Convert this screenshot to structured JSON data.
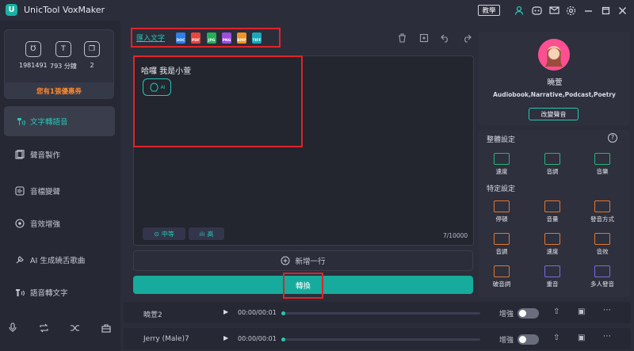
{
  "app": {
    "title": "UnicTool VoxMaker",
    "logo_letter": "U"
  },
  "titlebar": {
    "guide_label": "教學"
  },
  "stats": {
    "characters": "1981491",
    "minutes": "793 分鐘",
    "count": "2",
    "coupon": "您有1張優惠券"
  },
  "nav": {
    "items": [
      {
        "label": "文字轉語音",
        "active": true,
        "icon": "text-voice-icon"
      },
      {
        "label": "聲音製作",
        "icon": "voice-make-icon"
      },
      {
        "label": "音檔變聲",
        "icon": "voice-change-icon"
      },
      {
        "label": "音效增強",
        "icon": "enhance-icon"
      },
      {
        "label": "AI 生成繞舌歌曲",
        "icon": "rap-icon"
      },
      {
        "label": "語音轉文字",
        "icon": "speech-text-icon"
      }
    ]
  },
  "toolbar": {
    "import_label": "匯入文字",
    "file_types": [
      "DOC",
      "PDF",
      "JPG",
      "PNG",
      "BMP",
      "TIFF"
    ]
  },
  "editor": {
    "text": "哈囉 我是小萱",
    "ai_chip": "AI",
    "speed_pill": "中等",
    "pitch_pill": "高",
    "char_count": "7/10000"
  },
  "actions": {
    "new_line": "新增一行",
    "convert": "轉換"
  },
  "tracks": [
    {
      "name": "曉萱2",
      "time": "00:00/00:01",
      "enhance_label": "增強",
      "progress": 0
    },
    {
      "name": "Jerry (Male)7",
      "time": "00:00/00:01",
      "enhance_label": "增強",
      "progress": 0
    }
  ],
  "voice": {
    "name": "曉萱",
    "tags": "Audiobook,Narrative,Podcast,Poetry",
    "change_label": "改變聲音"
  },
  "settings": {
    "overall_title": "整體設定",
    "overall": [
      {
        "label": "速度"
      },
      {
        "label": "音調"
      },
      {
        "label": "音樂"
      }
    ],
    "specific_title": "特定設定",
    "specific": [
      {
        "label": "停頓"
      },
      {
        "label": "音量"
      },
      {
        "label": "發音方式"
      },
      {
        "label": "音調"
      },
      {
        "label": "速度"
      },
      {
        "label": "音效"
      },
      {
        "label": "破音詞"
      },
      {
        "label": "重音"
      },
      {
        "label": "多人發音"
      }
    ]
  },
  "colors": {
    "accent": "#16ab9c",
    "highlight": "#e0242a",
    "warning": "#ff8a2a"
  }
}
